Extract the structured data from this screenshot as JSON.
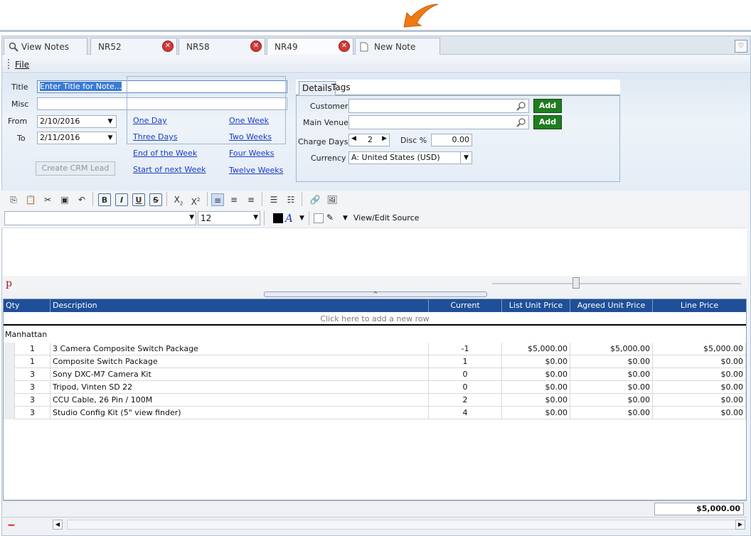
{
  "tabs": [
    {
      "label": "View Notes",
      "icon": "search-icon"
    },
    {
      "label": "NR52",
      "closable": true
    },
    {
      "label": "NR58",
      "closable": true
    },
    {
      "label": "NR49",
      "closable": true,
      "active": true
    },
    {
      "label": "New Note",
      "icon": "document-icon"
    }
  ],
  "menu": {
    "file": "File"
  },
  "header": {
    "title_label": "Title",
    "title_placeholder": "Enter Title for Note...",
    "misc_label": "Misc",
    "from_label": "From",
    "from_value": "2/10/2016",
    "to_label": "To",
    "to_value": "2/11/2016",
    "links": {
      "one_day": "One Day",
      "three_days": "Three Days",
      "end_of_week": "End of the Week",
      "start_next_week": "Start of next Week",
      "one_week": "One Week",
      "two_weeks": "Two Weeks",
      "four_weeks": "Four Weeks",
      "twelve_weeks": "Twelve Weeks"
    },
    "crm_button": "Create CRM Lead"
  },
  "details": {
    "tab_details": "Details",
    "tab_tags": "Tags",
    "customer_label": "Customer",
    "venue_label": "Main Venue",
    "add_label": "Add",
    "charge_days_label": "Charge Days",
    "charge_days_value": "2",
    "disc_label": "Disc %",
    "disc_value": "0.00",
    "currency_label": "Currency",
    "currency_value": "A: United States (USD)"
  },
  "editor": {
    "font_size": "12",
    "view_source": "View/Edit Source",
    "path_tag": "p"
  },
  "grid": {
    "columns": [
      "Qty",
      "Description",
      "Current Availability",
      "List Unit Price",
      "Agreed Unit Price",
      "Line Price"
    ],
    "add_row_text": "Click here to add a new row",
    "group": "Manhattan",
    "rows": [
      {
        "qty": "1",
        "desc": " 3 Camera Composite Switch Package",
        "avail": "-1",
        "list": "$5,000.00",
        "agreed": "$5,000.00",
        "line": "$5,000.00"
      },
      {
        "qty": "1",
        "desc": "Composite Switch Package",
        "avail": "1",
        "list": "$0.00",
        "agreed": "$0.00",
        "line": "$0.00"
      },
      {
        "qty": "3",
        "desc": "Sony DXC-M7 Camera Kit",
        "avail": "0",
        "list": "$0.00",
        "agreed": "$0.00",
        "line": "$0.00"
      },
      {
        "qty": "3",
        "desc": "Tripod, Vinten SD 22",
        "avail": "0",
        "list": "$0.00",
        "agreed": "$0.00",
        "line": "$0.00"
      },
      {
        "qty": "3",
        "desc": "CCU Cable,  26 Pin / 100M",
        "avail": "2",
        "list": "$0.00",
        "agreed": "$0.00",
        "line": "$0.00"
      },
      {
        "qty": "3",
        "desc": "Studio Config Kit (5\" view finder)",
        "avail": "4",
        "list": "$0.00",
        "agreed": "$0.00",
        "line": "$0.00"
      }
    ],
    "total": "$5,000.00"
  },
  "colors": {
    "header_blue": "#1f4f98",
    "add_green": "#1f7d1f",
    "close_red": "#d23a3a",
    "link_blue": "#1a3ec4"
  }
}
